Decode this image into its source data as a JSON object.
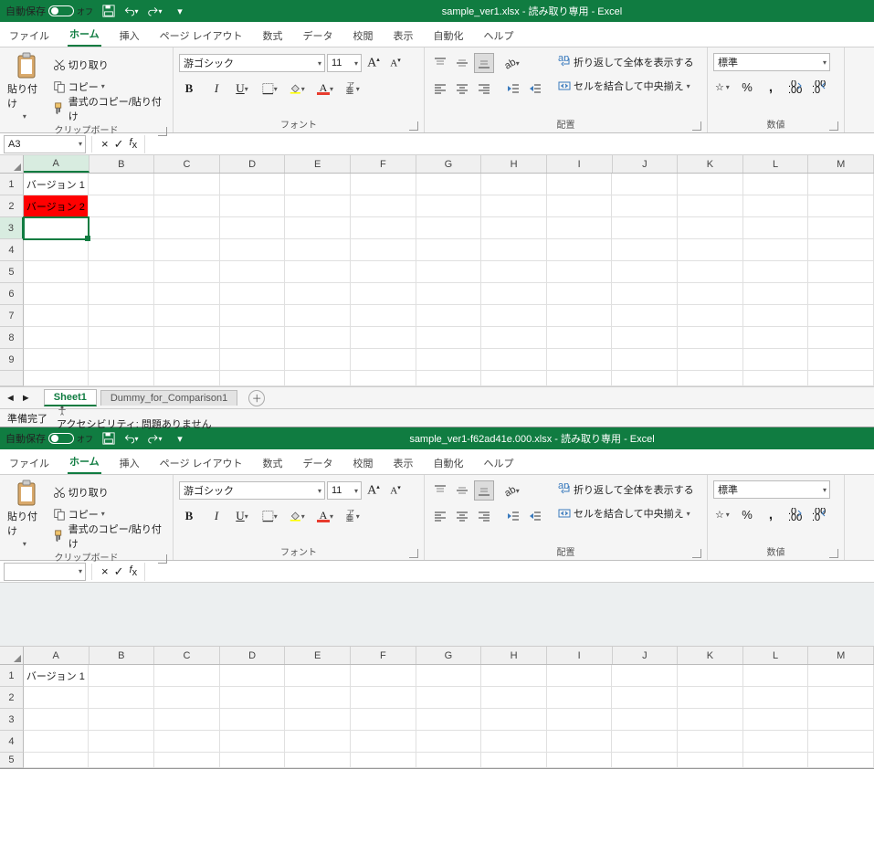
{
  "windows": [
    {
      "titlebar": {
        "autosave_label": "自動保存",
        "autosave_state": "オフ",
        "title": "sample_ver1.xlsx  -  読み取り専用  -  Excel"
      },
      "menu": {
        "file": "ファイル",
        "home": "ホーム",
        "insert": "挿入",
        "pagelayout": "ページ レイアウト",
        "formulas": "数式",
        "data": "データ",
        "review": "校閲",
        "view": "表示",
        "automate": "自動化",
        "help": "ヘルプ"
      },
      "ribbon": {
        "paste": "貼り付け",
        "cut": "切り取り",
        "copy": "コピー",
        "format_painter": "書式のコピー/貼り付け",
        "clipboard_label": "クリップボード",
        "font_name": "游ゴシック",
        "font_size": "11",
        "font_label": "フォント",
        "wrap": "折り返して全体を表示する",
        "merge": "セルを結合して中央揃え",
        "align_label": "配置",
        "number_format": "標準",
        "number_label": "数値"
      },
      "namebox": "A3",
      "formula": "",
      "columns": [
        "A",
        "B",
        "C",
        "D",
        "E",
        "F",
        "G",
        "H",
        "I",
        "J",
        "K",
        "L",
        "M"
      ],
      "sel_col": "A",
      "sel_row": 3,
      "cells": {
        "A1": "バージョン 1",
        "A2": "バージョン 2"
      },
      "row_count": 10,
      "sheets": [
        {
          "name": "Sheet1",
          "active": true
        },
        {
          "name": "Dummy_for_Comparison1",
          "active": false
        }
      ],
      "status": {
        "ready": "準備完了",
        "a11y": "アクセシビリティ: 問題ありません"
      }
    },
    {
      "titlebar": {
        "autosave_label": "自動保存",
        "autosave_state": "オフ",
        "title": "sample_ver1-f62ad41e.000.xlsx  -  読み取り専用  -  Excel"
      },
      "menu": {
        "file": "ファイル",
        "home": "ホーム",
        "insert": "挿入",
        "pagelayout": "ページ レイアウト",
        "formulas": "数式",
        "data": "データ",
        "review": "校閲",
        "view": "表示",
        "automate": "自動化",
        "help": "ヘルプ"
      },
      "ribbon": {
        "paste": "貼り付け",
        "cut": "切り取り",
        "copy": "コピー",
        "format_painter": "書式のコピー/貼り付け",
        "clipboard_label": "クリップボード",
        "font_name": "游ゴシック",
        "font_size": "11",
        "font_label": "フォント",
        "wrap": "折り返して全体を表示する",
        "merge": "セルを結合して中央揃え",
        "align_label": "配置",
        "number_format": "標準",
        "number_label": "数値"
      },
      "namebox": "",
      "formula": "",
      "columns": [
        "A",
        "B",
        "C",
        "D",
        "E",
        "F",
        "G",
        "H",
        "I",
        "J",
        "K",
        "L",
        "M"
      ],
      "sel_col": null,
      "sel_row": null,
      "cells": {
        "A1": "バージョン 1"
      },
      "row_count": 5,
      "sheets": [],
      "status": {}
    }
  ]
}
